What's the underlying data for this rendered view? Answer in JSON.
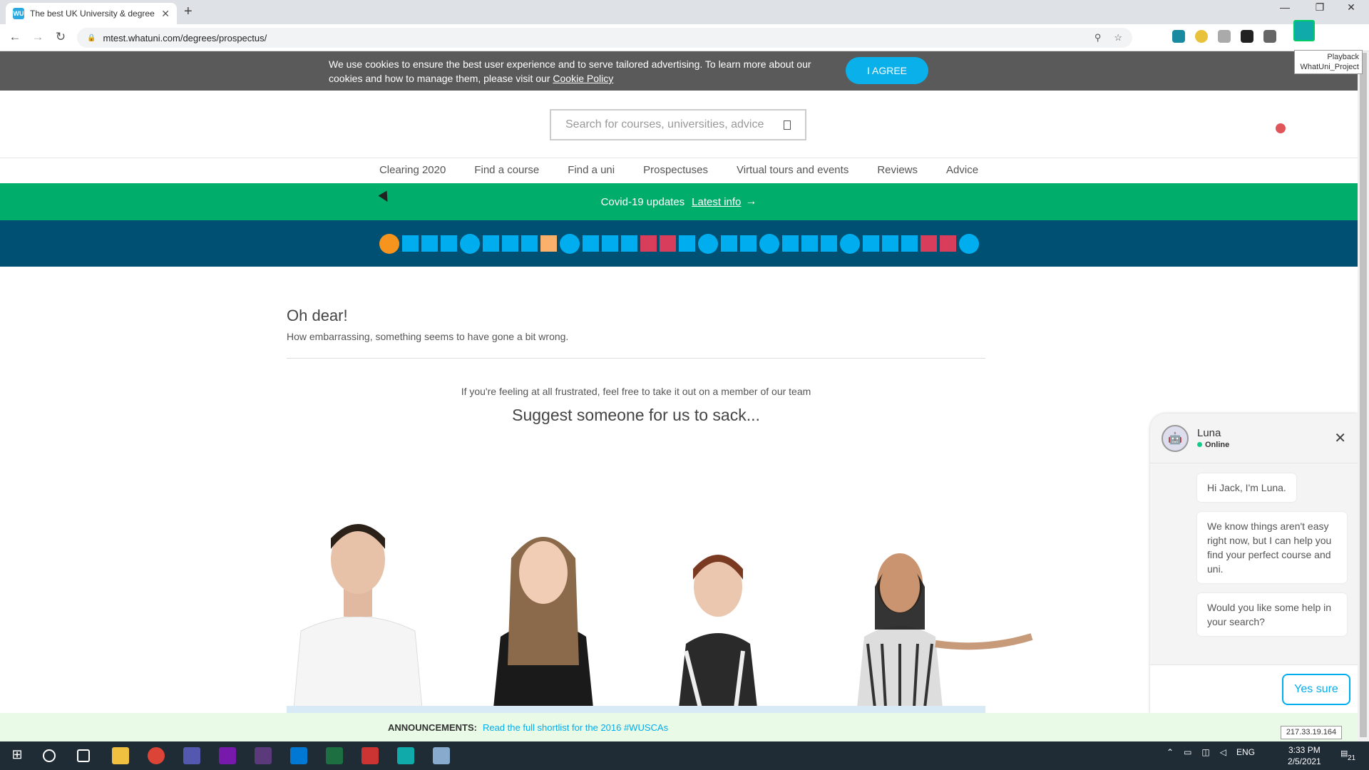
{
  "browser": {
    "tab_title": "The best UK University & degree",
    "tab_favicon": "WU",
    "url": "mtest.whatuni.com/degrees/prospectus/",
    "tooltip_line1": "Playback",
    "tooltip_line2": "WhatUni_Project"
  },
  "cookie": {
    "text": "We use cookies to ensure the best user experience and to serve tailored advertising. To learn more about our cookies and how to manage them, please visit our",
    "link": "Cookie Policy",
    "agree": "I AGREE"
  },
  "search": {
    "placeholder": "Search for courses, universities, advice"
  },
  "nav": [
    "Clearing 2020",
    "Find a course",
    "Find a uni",
    "Prospectuses",
    "Virtual tours and events",
    "Reviews",
    "Advice"
  ],
  "covid": {
    "text": "Covid-19 updates",
    "link": "Latest info"
  },
  "error": {
    "title": "Oh dear!",
    "subtitle": "How embarrassing, something seems to have gone a bit wrong.",
    "frustrated": "If you're feeling at all frustrated, feel free to take it out on a member of our team",
    "sack": "Suggest someone for us to sack..."
  },
  "chat": {
    "name": "Luna",
    "status": "Online",
    "messages": [
      "Hi Jack, I'm Luna.",
      "We know things aren't easy right now, but I can help you find your perfect course and uni.",
      "Would you like some help in your search?"
    ],
    "reply": "Yes sure"
  },
  "announce": {
    "label": "ANNOUNCEMENTS:",
    "link": "Read the full shortlist for the 2016 #WUSCAs"
  },
  "ip": "217.33.19.164",
  "taskbar": {
    "lang": "ENG",
    "time": "3:33 PM",
    "date": "2/5/2021",
    "notifications": "21"
  },
  "colors": {
    "brand_blue": "#00aeef",
    "covid_green": "#00ad6a",
    "shapes_bg": "#005073"
  }
}
